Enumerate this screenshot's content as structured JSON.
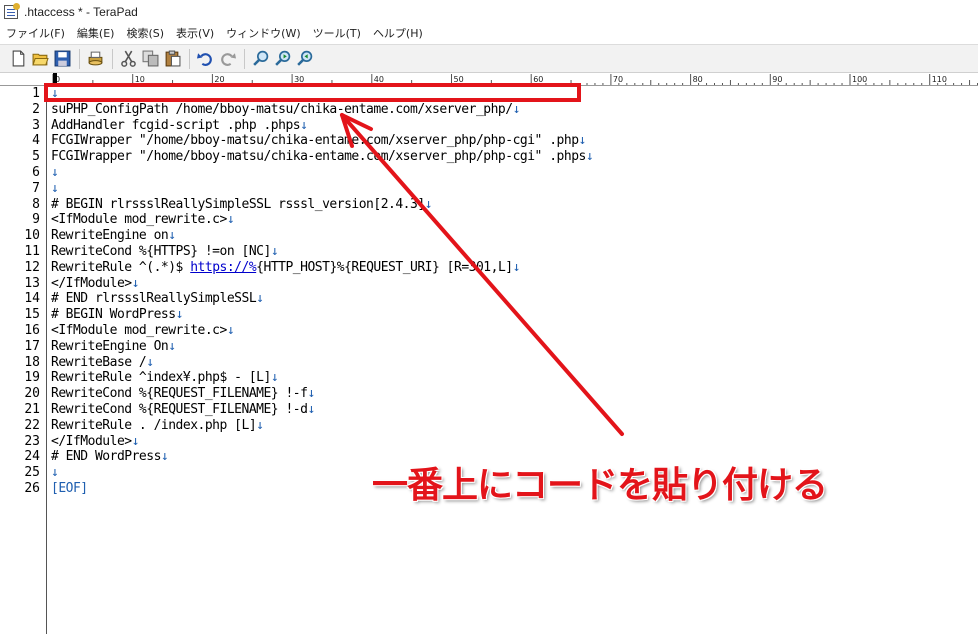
{
  "window": {
    "title": ".htaccess * - TeraPad"
  },
  "menu": [
    "ファイル(F)",
    "編集(E)",
    "検索(S)",
    "表示(V)",
    "ウィンドウ(W)",
    "ツール(T)",
    "ヘルプ(H)"
  ],
  "toolbar": {
    "icons": [
      "new-file-icon",
      "open-folder-icon",
      "save-icon",
      "print-icon",
      "cut-icon",
      "copy-icon",
      "paste-icon",
      "undo-icon",
      "redo-icon",
      "search-icon",
      "search-next-icon",
      "search-prev-icon"
    ]
  },
  "ruler": {
    "labels": [
      "0",
      "10",
      "20",
      "30",
      "40",
      "50",
      "60",
      "70",
      "80",
      "90",
      "100",
      "110"
    ]
  },
  "editor": {
    "eol_mark": "↓",
    "lines": [
      "",
      "suPHP_ConfigPath /home/bboy-matsu/chika-entame.com/xserver_php/",
      "AddHandler fcgid-script .php .phps",
      "FCGIWrapper \"/home/bboy-matsu/chika-entame.com/xserver_php/php-cgi\" .php",
      "FCGIWrapper \"/home/bboy-matsu/chika-entame.com/xserver_php/php-cgi\" .phps",
      "",
      "",
      "# BEGIN rlrssslReallySimpleSSL rsssl_version[2.4.3]",
      "<IfModule mod_rewrite.c>",
      "RewriteEngine on",
      "RewriteCond %{HTTPS} !=on [NC]",
      "RewriteRule ^(.*)$ https://%{HTTP_HOST}%{REQUEST_URI} [R=301,L]",
      "</IfModule>",
      "# END rlrssslReallySimpleSSL",
      "# BEGIN WordPress",
      "<IfModule mod_rewrite.c>",
      "RewriteEngine On",
      "RewriteBase /",
      "RewriteRule ^index¥.php$ - [L]",
      "RewriteCond %{REQUEST_FILENAME} !-f",
      "RewriteCond %{REQUEST_FILENAME} !-d",
      "RewriteRule . /index.php [L]",
      "</IfModule>",
      "# END WordPress",
      "",
      "[EOF]"
    ],
    "line_numbers": [
      "1",
      "2",
      "3",
      "4",
      "5",
      "6",
      "7",
      "8",
      "9",
      "10",
      "11",
      "12",
      "13",
      "14",
      "15",
      "16",
      "17",
      "18",
      "19",
      "20",
      "21",
      "22",
      "23",
      "24",
      "25",
      "26"
    ]
  },
  "annotation": {
    "text": "一番上にコードを貼り付ける",
    "color": "#e3141a"
  }
}
